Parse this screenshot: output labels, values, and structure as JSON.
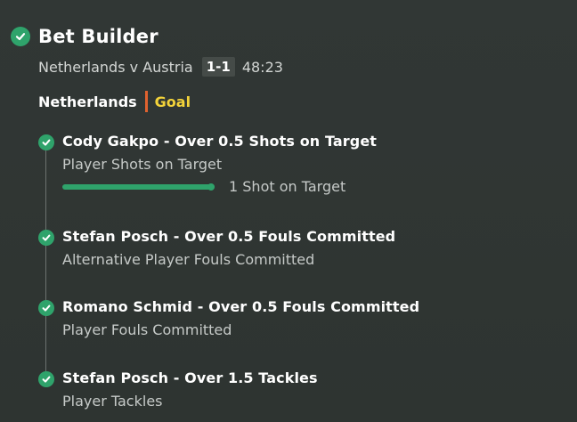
{
  "header": {
    "icon": "check-circle-icon",
    "title": "Bet Builder"
  },
  "match": {
    "fixture": "Netherlands v Austria",
    "score": "1-1",
    "clock": "48:23"
  },
  "event": {
    "team": "Netherlands",
    "type": "Goal"
  },
  "colors": {
    "accent_green": "#2fa36b",
    "goal_yellow": "#f3d33a",
    "divider_orange": "#e0622f",
    "background": "#2f3532"
  },
  "legs": [
    {
      "title": "Cody Gakpo - Over 0.5 Shots on Target",
      "market": "Player Shots on Target",
      "progress_label": "1 Shot on Target",
      "progress_fraction": 1.0
    },
    {
      "title": "Stefan Posch - Over 0.5 Fouls Committed",
      "market": "Alternative Player Fouls Committed"
    },
    {
      "title": "Romano Schmid - Over 0.5 Fouls Committed",
      "market": "Player Fouls Committed"
    },
    {
      "title": "Stefan Posch - Over 1.5 Tackles",
      "market": "Player Tackles"
    }
  ]
}
